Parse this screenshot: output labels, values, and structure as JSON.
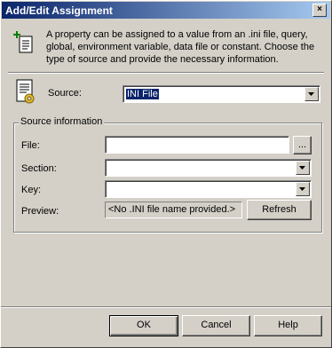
{
  "window": {
    "title": "Add/Edit Assignment",
    "close_glyph": "×"
  },
  "info_text": "A property can be assigned to a value from an .ini file, query, global, environment variable, data file or constant.  Choose the type of source and provide the necessary information.",
  "source": {
    "label": "Source:",
    "value": "INI File"
  },
  "group": {
    "title": "Source information"
  },
  "fields": {
    "file": {
      "label": "File:",
      "value": "",
      "browse_label": "..."
    },
    "section": {
      "label": "Section:",
      "value": ""
    },
    "key": {
      "label": "Key:",
      "value": ""
    },
    "preview": {
      "label": "Preview:",
      "value": "<No .INI file name provided.>",
      "refresh_label": "Refresh"
    }
  },
  "buttons": {
    "ok": "OK",
    "cancel": "Cancel",
    "help": "Help"
  },
  "icons": {
    "info": "add-document-icon",
    "source": "ini-file-icon",
    "dropdown": "chevron-down-icon"
  },
  "colors": {
    "title_start": "#0a246a",
    "title_end": "#a6caf0",
    "face": "#d4d0c8",
    "selection": "#0a246a"
  }
}
